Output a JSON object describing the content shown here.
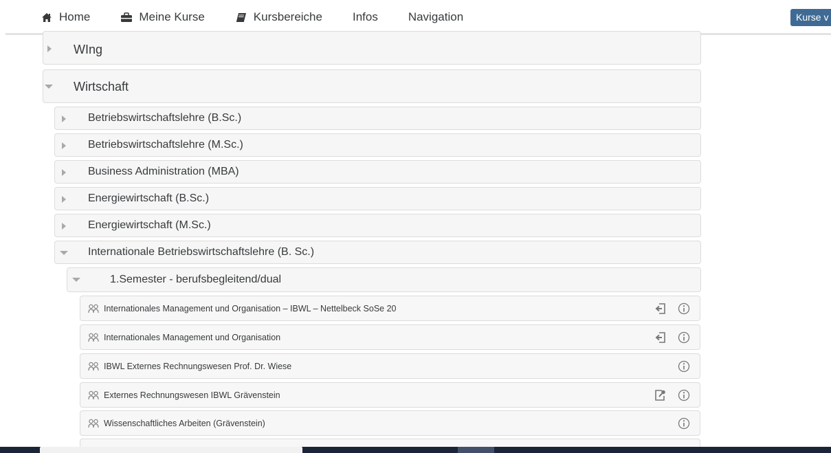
{
  "navbar": {
    "items": [
      {
        "label": "Home",
        "icon": "home-icon"
      },
      {
        "label": "Meine Kurse",
        "icon": "briefcase-icon"
      },
      {
        "label": "Kursbereiche",
        "icon": "book-icon"
      },
      {
        "label": "Infos",
        "icon": ""
      },
      {
        "label": "Navigation",
        "icon": ""
      }
    ],
    "right_button_label": "Kurse v"
  },
  "tree": {
    "level1": [
      {
        "label": "WIng",
        "expanded": false
      },
      {
        "label": "Wirtschaft",
        "expanded": true
      }
    ],
    "level2": [
      {
        "label": "Betriebswirtschaftslehre (B.Sc.)",
        "expanded": false
      },
      {
        "label": "Betriebswirtschaftslehre (M.Sc.)",
        "expanded": false
      },
      {
        "label": "Business Administration (MBA)",
        "expanded": false
      },
      {
        "label": "Energiewirtschaft (B.Sc.)",
        "expanded": false
      },
      {
        "label": "Energiewirtschaft (M.Sc.)",
        "expanded": false
      },
      {
        "label": "Internationale Betriebswirtschaftslehre (B. Sc.)",
        "expanded": true
      }
    ],
    "level3": [
      {
        "label": "1.Semester - berufsbegleitend/dual",
        "expanded": true
      }
    ],
    "courses": [
      {
        "label": "Internationales Management und Organisation – IBWL – Nettelbeck SoSe 20",
        "actions": [
          "enrol-icon",
          "info-icon"
        ]
      },
      {
        "label": "Internationales Management und Organisation",
        "actions": [
          "enrol-icon",
          "info-icon"
        ]
      },
      {
        "label": "IBWL Externes Rechnungswesen Prof. Dr. Wiese",
        "actions": [
          "info-icon"
        ]
      },
      {
        "label": "Externes Rechnungswesen IBWL Grävenstein",
        "actions": [
          "key-enrol-icon",
          "info-icon"
        ]
      },
      {
        "label": "Wissenschaftliches Arbeiten (Grävenstein)",
        "actions": [
          "info-icon"
        ]
      }
    ]
  },
  "colors": {
    "nav_button_bg": "#3f6a94",
    "node_bg": "#f6f6f6",
    "node_border": "#dcdcdc",
    "taskbar_bg": "#1c2538"
  }
}
